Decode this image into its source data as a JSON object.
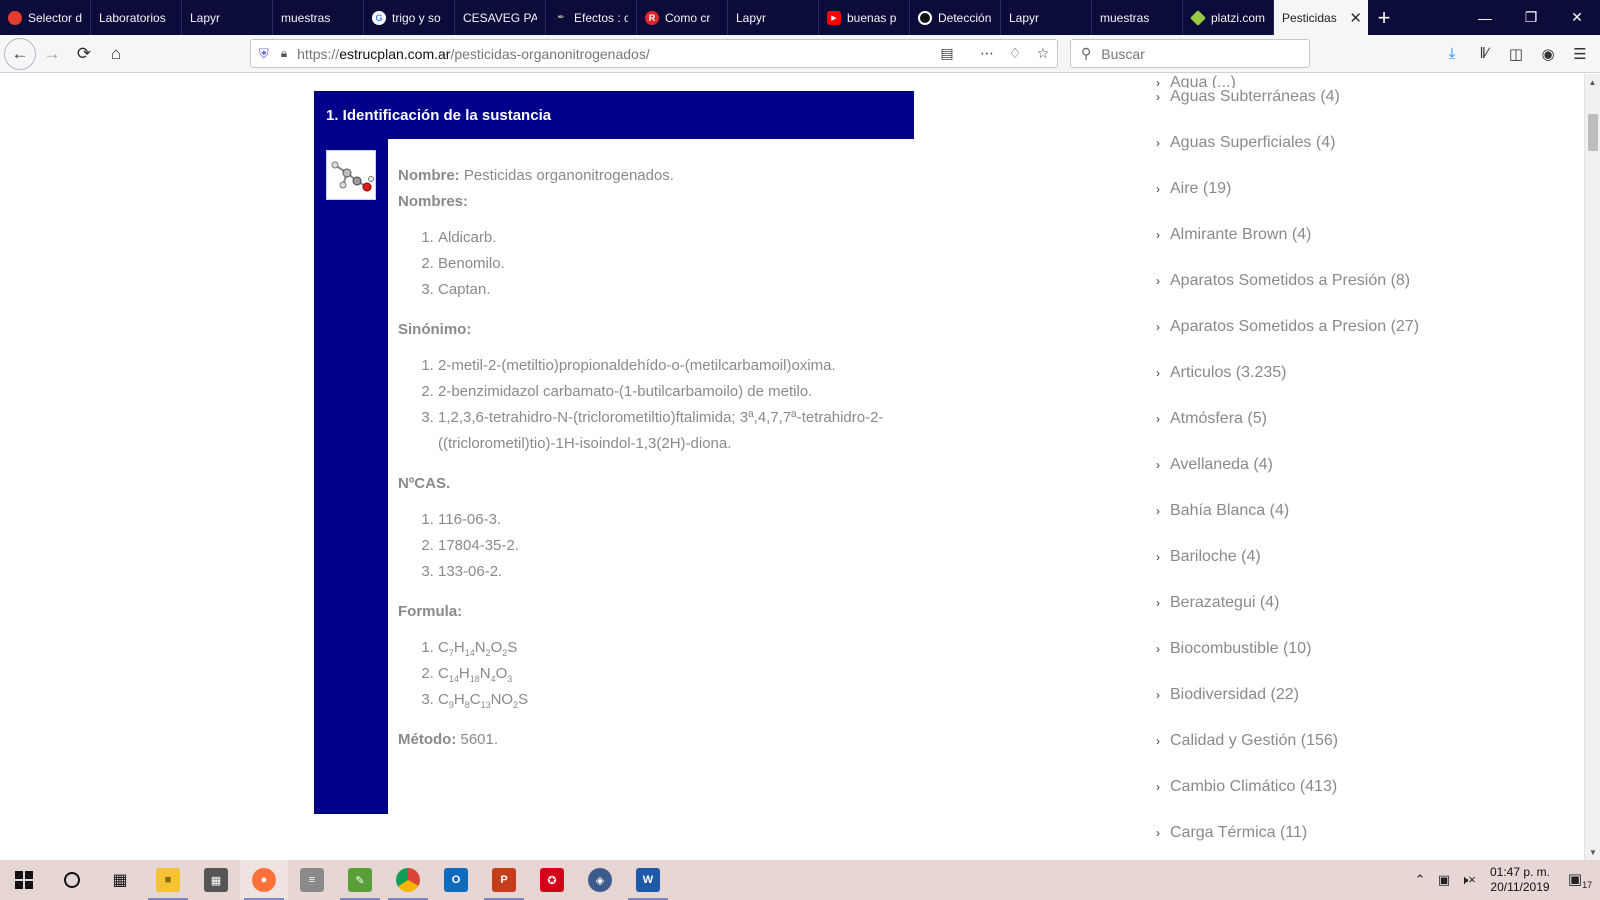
{
  "browser": {
    "tabs": [
      {
        "label": "Selector d",
        "fav": "red-circle",
        "color": "#e33b2e"
      },
      {
        "label": "Laboratorios",
        "fav": "",
        "color": ""
      },
      {
        "label": "Lapyr",
        "fav": "",
        "color": ""
      },
      {
        "label": "muestras",
        "fav": "",
        "color": ""
      },
      {
        "label": "trigo y so",
        "fav": "google-g",
        "color": "#ffffff"
      },
      {
        "label": "CESAVEG PAR",
        "fav": "",
        "color": ""
      },
      {
        "label": "Efectos : c",
        "fav": "pen-icon",
        "color": "#888888"
      },
      {
        "label": "Como cr",
        "fav": "r-icon",
        "color": "#e0242b"
      },
      {
        "label": "Lapyr",
        "fav": "",
        "color": ""
      },
      {
        "label": "buenas p",
        "fav": "youtube-icon",
        "color": "#ff0000"
      },
      {
        "label": "Detección",
        "fav": "circle-icon",
        "color": "#111111"
      },
      {
        "label": "Lapyr",
        "fav": "",
        "color": ""
      },
      {
        "label": "muestras",
        "fav": "",
        "color": ""
      },
      {
        "label": "platzi.com",
        "fav": "platzi-icon",
        "color": "#98ca3f"
      },
      {
        "label": "Pesticidas",
        "fav": "",
        "color": "",
        "active": true
      }
    ],
    "url_prefix": "https://",
    "url_domain": "estrucplan.com.ar",
    "url_path": "/pesticidas-organonitrogenados/",
    "search_placeholder": "Buscar"
  },
  "substance": {
    "header": "1. Identificación de la sustancia",
    "nombre_label": "Nombre:",
    "nombre_value": " Pesticidas organonitrogenados.",
    "nombres_label": "Nombres:",
    "nombres": [
      "Aldicarb.",
      "Benomilo.",
      "Captan."
    ],
    "sinonimo_label": "Sinónimo:",
    "sinonimos": [
      "2-metil-2-(metiltio)propionaldehído-o-(metilcarbamoil)oxima.",
      "2-benzimidazol carbamato-(1-butilcarbamoilo) de metilo.",
      "1,2,3,6-tetrahidro-N-(triclorometiltio)ftalimida; 3ª,4,7,7ª-tetrahidro-2-((triclorometil)tio)-1H-isoindol-1,3(2H)-diona."
    ],
    "cas_label": "NºCAS.",
    "cas": [
      "116-06-3.",
      "17804-35-2.",
      "133-06-2."
    ],
    "formula_label": "Formula:",
    "formulas": [
      [
        [
          "C",
          ""
        ],
        [
          "7",
          "sub"
        ],
        [
          "H",
          ""
        ],
        [
          "14",
          "sub"
        ],
        [
          "N",
          ""
        ],
        [
          "2",
          "sub"
        ],
        [
          "O",
          ""
        ],
        [
          "2",
          "sub"
        ],
        [
          "S",
          ""
        ]
      ],
      [
        [
          "C",
          ""
        ],
        [
          "14",
          "sub"
        ],
        [
          "H",
          ""
        ],
        [
          "18",
          "sub"
        ],
        [
          "N",
          ""
        ],
        [
          "4",
          "sub"
        ],
        [
          "O",
          ""
        ],
        [
          "3",
          "sub"
        ]
      ],
      [
        [
          "C",
          ""
        ],
        [
          "9",
          "sub"
        ],
        [
          "H",
          ""
        ],
        [
          "8",
          "sub"
        ],
        [
          "C",
          ""
        ],
        [
          "13",
          "sub"
        ],
        [
          "NO",
          ""
        ],
        [
          "2",
          "sub"
        ],
        [
          "S",
          ""
        ]
      ]
    ],
    "metodo_label": "Método:",
    "metodo_value": " 5601."
  },
  "categories": [
    "Agua (...)",
    "Aguas Subterráneas (4)",
    "Aguas Superficiales (4)",
    "Aire (19)",
    "Almirante Brown (4)",
    "Aparatos Sometidos a Presión (8)",
    "Aparatos Sometidos a Presion (27)",
    "Articulos (3.235)",
    "Atmósfera (5)",
    "Avellaneda (4)",
    "Bahía Blanca (4)",
    "Bariloche (4)",
    "Berazategui (4)",
    "Biocombustible (10)",
    "Biodiversidad (22)",
    "Calidad y Gestión (156)",
    "Cambio Climático (413)",
    "Carga Térmica (11)"
  ],
  "taskbar": {
    "clock_time": "01:47 p. m.",
    "clock_date": "20/11/2019",
    "notif_count": "17"
  }
}
